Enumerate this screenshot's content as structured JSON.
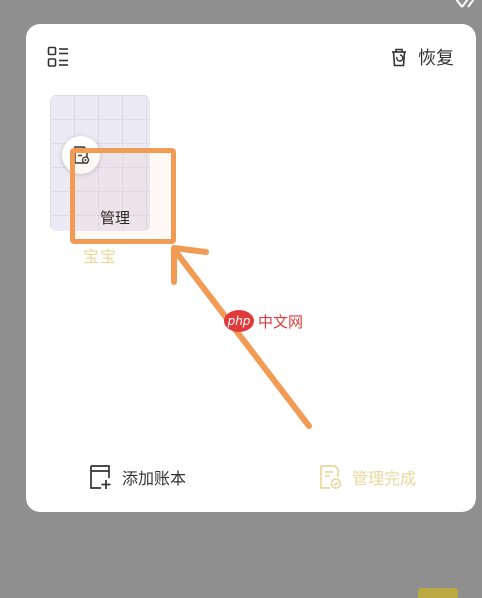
{
  "header": {
    "list_icon": "list-view-icon",
    "restore_icon": "trash-restore-icon",
    "restore_label": "恢复"
  },
  "book": {
    "name": "宝宝",
    "manage_icon": "document-settings-icon",
    "manage_label": "管理"
  },
  "watermark": {
    "logo_text": "php",
    "text": "中文网"
  },
  "footer": {
    "add_icon": "add-book-icon",
    "add_label": "添加账本",
    "done_icon": "document-check-icon",
    "done_label": "管理完成"
  },
  "colors": {
    "highlight": "#f29b55",
    "accent_muted": "#ead79a",
    "background": "#8f8f8f",
    "watermark": "#e03a3a"
  }
}
